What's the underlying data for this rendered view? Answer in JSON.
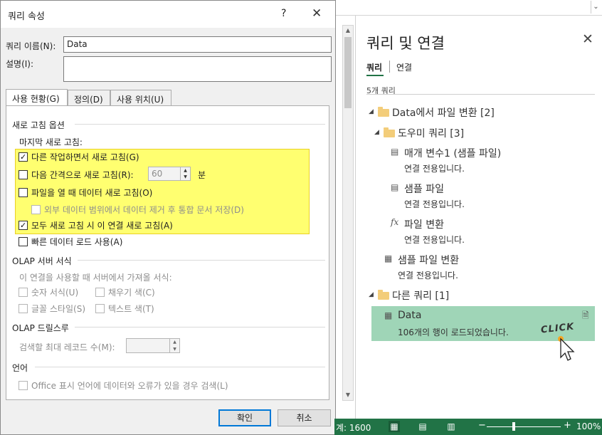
{
  "dialog": {
    "title": "쿼리 속성",
    "help": "?",
    "close": "✕",
    "name_label": "쿼리 이름(N):",
    "name_value": "Data",
    "desc_label": "설명(I):",
    "tabs": [
      {
        "label": "사용 현황(G)"
      },
      {
        "label": "정의(D)"
      },
      {
        "label": "사용 위치(U)"
      }
    ],
    "refresh_section": "새로 고침 옵션",
    "last_refresh": "마지막 새로 고침:",
    "opt_background": "다른 작업하면서 새로 고침(G)",
    "opt_interval": "다음 간격으로 새로 고침(R):",
    "interval_value": "60",
    "interval_unit": "분",
    "opt_open": "파일을 열 때 데이터 새로 고침(O)",
    "opt_remove": "외부 데이터 범위에서 데이터 제거 후 통합 문서 저장(D)",
    "opt_all": "모두 새로 고침 시 이 연결 새로 고침(A)",
    "opt_fast": "빠른 데이터 로드 사용(A)",
    "olap_section": "OLAP 서버 서식",
    "olap_desc": "이 연결을 사용할 때 서버에서 가져올 서식:",
    "opt_number": "숫자 서식(U)",
    "opt_fill": "채우기 색(C)",
    "opt_font": "글꼴 스타일(S)",
    "opt_text": "텍스트 색(T)",
    "drill_section": "OLAP 드릴스루",
    "drill_label": "검색할 최대 레코드 수(M):",
    "lang_section": "언어",
    "opt_lang": "Office 표시 언어에 데이터와 오류가 있을 경우 검색(L)",
    "ok": "확인",
    "cancel": "취소"
  },
  "pane": {
    "title": "쿼리 및 연결",
    "close": "✕",
    "tab_queries": "쿼리",
    "tab_connections": "연결",
    "count": "5개 쿼리",
    "group1": "Data에서 파일 변환 [2]",
    "group2": "도우미 쿼리 [3]",
    "q1": "매개 변수1 (샘플 파일)",
    "q1_sub": "연결 전용입니다.",
    "q2": "샘플 파일",
    "q2_sub": "연결 전용입니다.",
    "q3": "파일 변환",
    "q3_sub": "연결 전용입니다.",
    "q4": "샘플 파일 변환",
    "q4_sub": "연결 전용입니다.",
    "group3": "다른 쿼리 [1]",
    "q5": "Data",
    "q5_sub": "106개의 행이 로드되었습니다.",
    "click_label": "CLICK"
  },
  "status": {
    "count": "계: 1600",
    "zoom": "100%"
  }
}
